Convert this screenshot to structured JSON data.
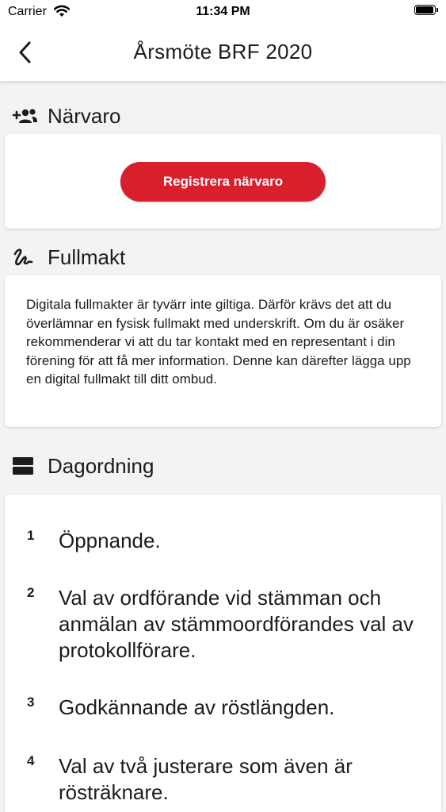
{
  "status_bar": {
    "carrier": "Carrier",
    "time": "11:34 PM"
  },
  "nav": {
    "title": "Årsmöte BRF 2020",
    "back_icon": "chevron-left-icon"
  },
  "attendance": {
    "title": "Närvaro",
    "icon": "add-group-icon",
    "button_label": "Registrera närvaro",
    "button_color": "#d91e2c"
  },
  "proxy": {
    "title": "Fullmakt",
    "icon": "signature-icon",
    "text": "Digitala fullmakter är tyvärr inte giltiga. Därför krävs det att du överlämnar en fysisk fullmakt med underskrift. Om du är osäker rekommenderar vi att du tar kontakt med en representant i din förening för att få mer information. Denne kan därefter lägga upp en digital fullmakt till ditt ombud."
  },
  "agenda": {
    "title": "Dagordning",
    "icon": "agenda-icon",
    "items": [
      {
        "number": "1",
        "text": "Öppnande."
      },
      {
        "number": "2",
        "text": "Val av ordförande vid stämman och anmälan av stämmoordförandes val av protokollförare."
      },
      {
        "number": "3",
        "text": "Godkännande av röstlängden."
      },
      {
        "number": "4",
        "text": "Val av två justerare som även är rösträknare."
      }
    ]
  }
}
